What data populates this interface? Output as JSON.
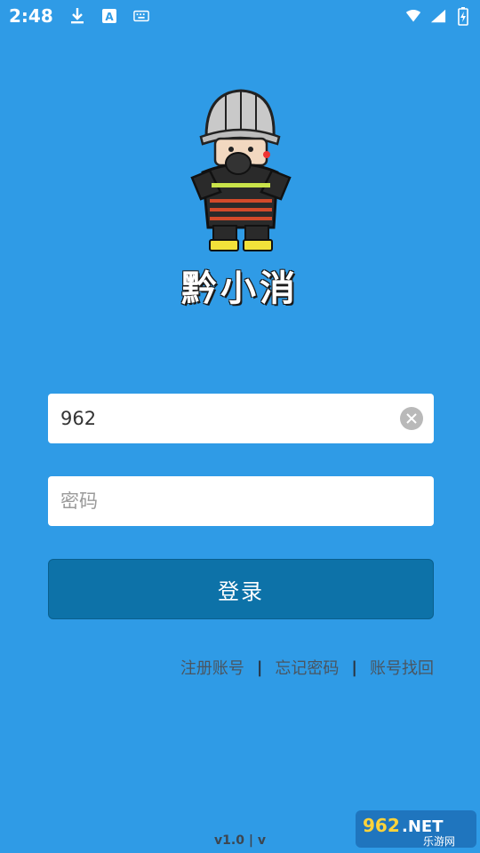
{
  "status_bar": {
    "time": "2:48",
    "left_icons": [
      "download-icon",
      "text-a-icon",
      "keyboard-icon"
    ],
    "right_icons": [
      "wifi-icon",
      "signal-icon",
      "battery-charging-icon"
    ]
  },
  "app": {
    "name": "黔小消"
  },
  "login_form": {
    "username_value": "962",
    "password_placeholder": "密码",
    "login_label": "登录"
  },
  "links": {
    "register": "注册账号",
    "forgot_password": "忘记密码",
    "recover_account": "账号找回",
    "separator": "|"
  },
  "footer": {
    "version": "v1.0 | v"
  },
  "watermark": {
    "logo_text": "962.NET",
    "sub_text": "乐游网"
  },
  "colors": {
    "background": "#2f9be6",
    "button": "#0d72a8",
    "link_text": "#4a5560"
  }
}
